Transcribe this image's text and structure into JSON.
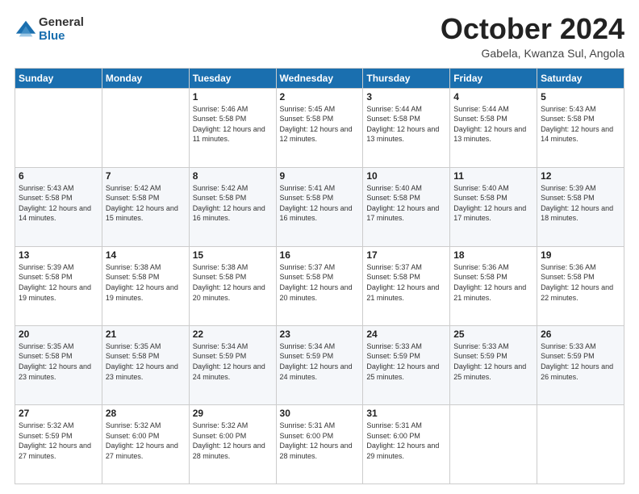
{
  "logo": {
    "general": "General",
    "blue": "Blue"
  },
  "header": {
    "month": "October 2024",
    "location": "Gabela, Kwanza Sul, Angola"
  },
  "weekdays": [
    "Sunday",
    "Monday",
    "Tuesday",
    "Wednesday",
    "Thursday",
    "Friday",
    "Saturday"
  ],
  "weeks": [
    [
      {
        "day": "",
        "info": ""
      },
      {
        "day": "",
        "info": ""
      },
      {
        "day": "1",
        "info": "Sunrise: 5:46 AM\nSunset: 5:58 PM\nDaylight: 12 hours and 11 minutes."
      },
      {
        "day": "2",
        "info": "Sunrise: 5:45 AM\nSunset: 5:58 PM\nDaylight: 12 hours and 12 minutes."
      },
      {
        "day": "3",
        "info": "Sunrise: 5:44 AM\nSunset: 5:58 PM\nDaylight: 12 hours and 13 minutes."
      },
      {
        "day": "4",
        "info": "Sunrise: 5:44 AM\nSunset: 5:58 PM\nDaylight: 12 hours and 13 minutes."
      },
      {
        "day": "5",
        "info": "Sunrise: 5:43 AM\nSunset: 5:58 PM\nDaylight: 12 hours and 14 minutes."
      }
    ],
    [
      {
        "day": "6",
        "info": "Sunrise: 5:43 AM\nSunset: 5:58 PM\nDaylight: 12 hours and 14 minutes."
      },
      {
        "day": "7",
        "info": "Sunrise: 5:42 AM\nSunset: 5:58 PM\nDaylight: 12 hours and 15 minutes."
      },
      {
        "day": "8",
        "info": "Sunrise: 5:42 AM\nSunset: 5:58 PM\nDaylight: 12 hours and 16 minutes."
      },
      {
        "day": "9",
        "info": "Sunrise: 5:41 AM\nSunset: 5:58 PM\nDaylight: 12 hours and 16 minutes."
      },
      {
        "day": "10",
        "info": "Sunrise: 5:40 AM\nSunset: 5:58 PM\nDaylight: 12 hours and 17 minutes."
      },
      {
        "day": "11",
        "info": "Sunrise: 5:40 AM\nSunset: 5:58 PM\nDaylight: 12 hours and 17 minutes."
      },
      {
        "day": "12",
        "info": "Sunrise: 5:39 AM\nSunset: 5:58 PM\nDaylight: 12 hours and 18 minutes."
      }
    ],
    [
      {
        "day": "13",
        "info": "Sunrise: 5:39 AM\nSunset: 5:58 PM\nDaylight: 12 hours and 19 minutes."
      },
      {
        "day": "14",
        "info": "Sunrise: 5:38 AM\nSunset: 5:58 PM\nDaylight: 12 hours and 19 minutes."
      },
      {
        "day": "15",
        "info": "Sunrise: 5:38 AM\nSunset: 5:58 PM\nDaylight: 12 hours and 20 minutes."
      },
      {
        "day": "16",
        "info": "Sunrise: 5:37 AM\nSunset: 5:58 PM\nDaylight: 12 hours and 20 minutes."
      },
      {
        "day": "17",
        "info": "Sunrise: 5:37 AM\nSunset: 5:58 PM\nDaylight: 12 hours and 21 minutes."
      },
      {
        "day": "18",
        "info": "Sunrise: 5:36 AM\nSunset: 5:58 PM\nDaylight: 12 hours and 21 minutes."
      },
      {
        "day": "19",
        "info": "Sunrise: 5:36 AM\nSunset: 5:58 PM\nDaylight: 12 hours and 22 minutes."
      }
    ],
    [
      {
        "day": "20",
        "info": "Sunrise: 5:35 AM\nSunset: 5:58 PM\nDaylight: 12 hours and 23 minutes."
      },
      {
        "day": "21",
        "info": "Sunrise: 5:35 AM\nSunset: 5:58 PM\nDaylight: 12 hours and 23 minutes."
      },
      {
        "day": "22",
        "info": "Sunrise: 5:34 AM\nSunset: 5:59 PM\nDaylight: 12 hours and 24 minutes."
      },
      {
        "day": "23",
        "info": "Sunrise: 5:34 AM\nSunset: 5:59 PM\nDaylight: 12 hours and 24 minutes."
      },
      {
        "day": "24",
        "info": "Sunrise: 5:33 AM\nSunset: 5:59 PM\nDaylight: 12 hours and 25 minutes."
      },
      {
        "day": "25",
        "info": "Sunrise: 5:33 AM\nSunset: 5:59 PM\nDaylight: 12 hours and 25 minutes."
      },
      {
        "day": "26",
        "info": "Sunrise: 5:33 AM\nSunset: 5:59 PM\nDaylight: 12 hours and 26 minutes."
      }
    ],
    [
      {
        "day": "27",
        "info": "Sunrise: 5:32 AM\nSunset: 5:59 PM\nDaylight: 12 hours and 27 minutes."
      },
      {
        "day": "28",
        "info": "Sunrise: 5:32 AM\nSunset: 6:00 PM\nDaylight: 12 hours and 27 minutes."
      },
      {
        "day": "29",
        "info": "Sunrise: 5:32 AM\nSunset: 6:00 PM\nDaylight: 12 hours and 28 minutes."
      },
      {
        "day": "30",
        "info": "Sunrise: 5:31 AM\nSunset: 6:00 PM\nDaylight: 12 hours and 28 minutes."
      },
      {
        "day": "31",
        "info": "Sunrise: 5:31 AM\nSunset: 6:00 PM\nDaylight: 12 hours and 29 minutes."
      },
      {
        "day": "",
        "info": ""
      },
      {
        "day": "",
        "info": ""
      }
    ]
  ]
}
